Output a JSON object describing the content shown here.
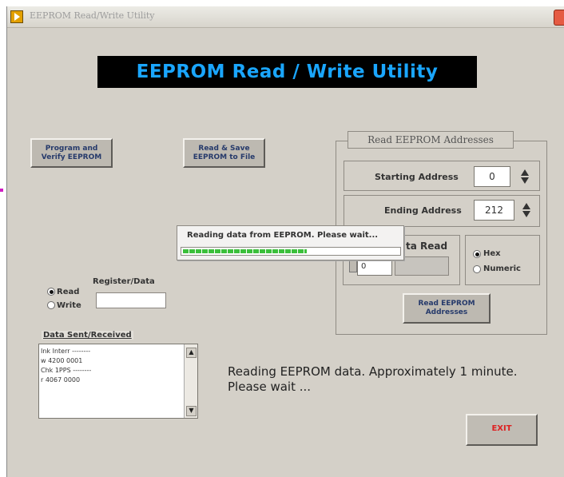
{
  "window": {
    "title": "EEPROM Read/Write Utility"
  },
  "header": {
    "banner_text": "EEPROM  Read / Write  Utility"
  },
  "buttons": {
    "program_verify": "Program and\nVerify EEPROM",
    "read_save": "Read & Save\nEEPROM to File",
    "read_addresses": "Read EEPROM\nAddresses",
    "exit": "EXIT"
  },
  "address_group": {
    "title": "Read EEPROM  Addresses",
    "starting_label": "Starting Address",
    "starting_value": "0",
    "ending_label": "Ending Address",
    "ending_value": "212",
    "data_read_label_visible": "ta Read",
    "small_value": "0",
    "format_options": [
      {
        "label": "Hex",
        "selected": true
      },
      {
        "label": "Numeric",
        "selected": false
      }
    ]
  },
  "register": {
    "label": "Register/Data",
    "modes": [
      {
        "label": "Read",
        "selected": true
      },
      {
        "label": "Write",
        "selected": false
      }
    ],
    "value": ""
  },
  "log": {
    "label": "Data Sent/Received",
    "lines": [
      "Ink Interr --------",
      "w 4200 0001",
      "Chk 1PPS --------",
      "r 4067 0000"
    ]
  },
  "status_message": "Reading EEPROM data. Approximately 1 minute. Please wait ...",
  "dialog": {
    "message": "Reading data from EEPROM.  Please wait...",
    "progress": 0.58
  },
  "colors": {
    "banner_bg": "#000000",
    "banner_text": "#1aa6ff",
    "progress_fill": "#3bbf3b",
    "exit_text": "#d22222"
  },
  "icons": {
    "app_icon": "labview-run-icon",
    "close_icon": "close-icon"
  }
}
